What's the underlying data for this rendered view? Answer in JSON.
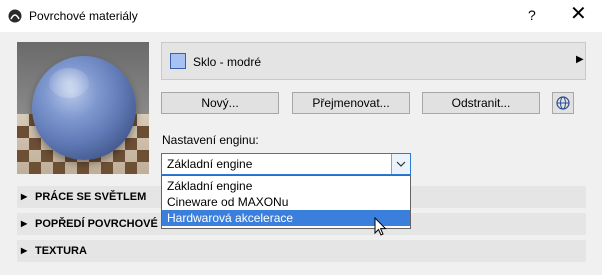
{
  "window": {
    "title": "Povrchové materiály",
    "help_label": "?",
    "close_label": "✕"
  },
  "material": {
    "name": "Sklo - modré",
    "swatch_color": "#a6c1f2",
    "arrow": "▶"
  },
  "buttons": {
    "new_label": "Nový...",
    "rename_label": "Přejmenovat...",
    "delete_label": "Odstranit..."
  },
  "engine": {
    "label": "Nastavení enginu:",
    "selected": "Základní engine",
    "options": [
      "Základní engine",
      "Cineware od MAXONu",
      "Hardwarová akcelerace"
    ],
    "highlighted_option": "Hardwarová akcelerace"
  },
  "sections": [
    {
      "label": "PRÁCE SE SVĚTLEM"
    },
    {
      "label": "POPŘEDÍ POVRCHOVÉ V"
    },
    {
      "label": "TEXTURA"
    }
  ],
  "icons": {
    "app": "archicad-app-icon",
    "globe": "globe-icon",
    "dropdown": "chevron-down-icon",
    "section": "triangle-right-icon",
    "cursor": "mouse-cursor-icon"
  }
}
